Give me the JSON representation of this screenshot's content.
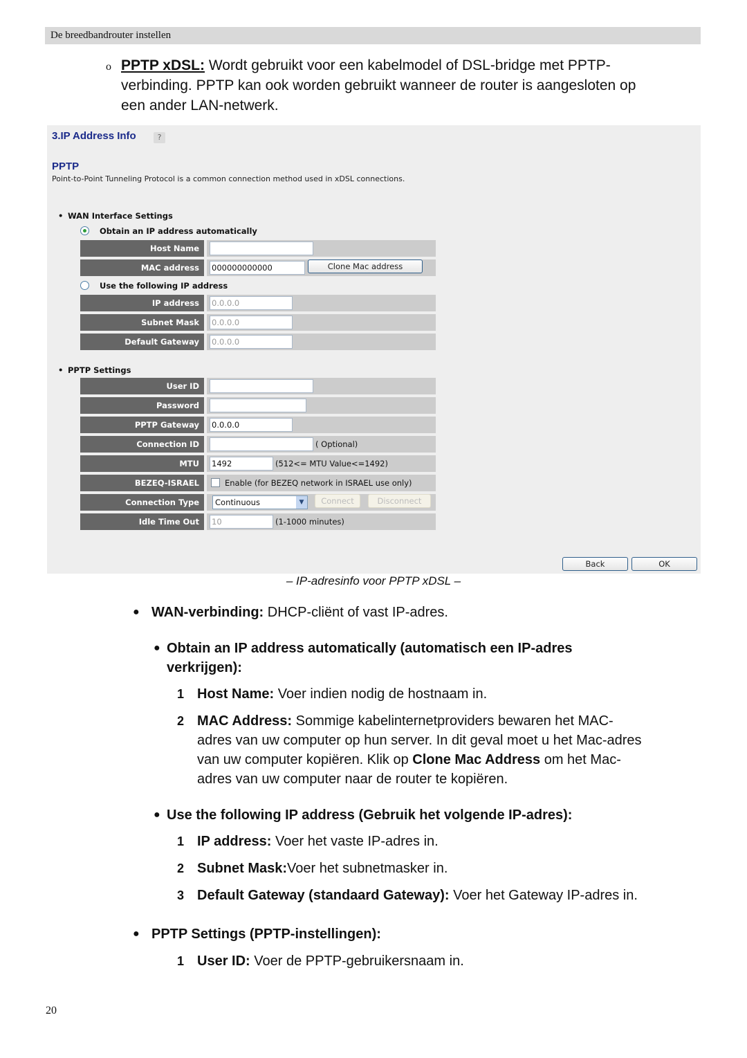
{
  "header": {
    "running_title": "De breedbandrouter instellen"
  },
  "intro": {
    "bullet": "o",
    "term": "PPTP xDSL:",
    "line1": " Wordt gebruikt voor een kabelmodel of DSL-bridge met PPTP-",
    "line2": "verbinding. PPTP kan ook worden gebruikt wanneer de router is aangesloten op",
    "line3": "een ander LAN-netwerk."
  },
  "screenshot": {
    "title": "3.IP Address Info",
    "help_icon": "help-icon",
    "section_title": "PPTP",
    "description": "Point-to-Point Tunneling Protocol is a common connection method used in xDSL connections.",
    "wan_heading": "WAN Interface Settings",
    "radio_auto": {
      "label": "Obtain an IP address automatically",
      "checked": true
    },
    "radio_manual": {
      "label": "Use the following IP address",
      "checked": false
    },
    "host_name": {
      "label": "Host Name",
      "value": ""
    },
    "mac_address": {
      "label": "MAC address",
      "value": "000000000000",
      "button": "Clone Mac address"
    },
    "ip_address": {
      "label": "IP address",
      "value": "0.0.0.0"
    },
    "subnet_mask": {
      "label": "Subnet Mask",
      "value": "0.0.0.0"
    },
    "default_gateway": {
      "label": "Default Gateway",
      "value": "0.0.0.0"
    },
    "pptp_heading": "PPTP Settings",
    "user_id": {
      "label": "User ID",
      "value": ""
    },
    "password": {
      "label": "Password",
      "value": ""
    },
    "pptp_gateway": {
      "label": "PPTP Gateway",
      "value": "0.0.0.0"
    },
    "connection_id": {
      "label": "Connection ID",
      "value": "",
      "note": "( Optional)"
    },
    "mtu": {
      "label": "MTU",
      "value": "1492",
      "note": "(512<= MTU Value<=1492)"
    },
    "bezeq": {
      "label": "BEZEQ-ISRAEL",
      "checked": false,
      "note": "Enable (for BEZEQ network in ISRAEL use only)"
    },
    "connection_type": {
      "label": "Connection Type",
      "selected": "Continuous",
      "connect": "Connect",
      "disconnect": "Disconnect"
    },
    "idle_timeout": {
      "label": "Idle Time Out",
      "value": "10",
      "note": "(1-1000 minutes)"
    },
    "back": "Back",
    "ok": "OK"
  },
  "caption": "– IP-adresinfo voor PPTP xDSL –",
  "items": {
    "wan": {
      "term": "WAN-verbinding:",
      "text": " DHCP-cliënt of vast IP-adres."
    },
    "obtain": {
      "line1": "Obtain an IP address automatically (automatisch een IP-adres",
      "line2": "verkrijgen):"
    },
    "obtain_list": [
      {
        "num": "1",
        "term": "Host Name:",
        "text": " Voer indien nodig de hostnaam in."
      },
      {
        "num": "2",
        "term": "MAC Address:",
        "l1": " Sommige kabelinternetproviders bewaren het MAC-",
        "l2": "adres van uw computer op hun server. In dit geval moet u het Mac-adres",
        "l3a": "van uw computer kopiëren. Klik op ",
        "l3b": "Clone Mac Address",
        "l3c": " om het Mac-",
        "l4": "adres van uw computer naar de router te kopiëren."
      }
    ],
    "use": {
      "text": "Use the following IP address (Gebruik het volgende IP-adres):"
    },
    "use_list": [
      {
        "num": "1",
        "term": "IP address:",
        "text": " Voer het vaste IP-adres in."
      },
      {
        "num": "2",
        "term": "Subnet Mask:",
        "text": "Voer het subnetmasker in."
      },
      {
        "num": "3",
        "term": "Default Gateway (standaard Gateway):",
        "text": " Voer het Gateway IP-adres in."
      }
    ],
    "pptp": {
      "text": "PPTP Settings (PPTP-instellingen):"
    },
    "pptp_list": [
      {
        "num": "1",
        "term": "User ID:",
        "text": " Voer de PPTP-gebruikersnaam in."
      }
    ]
  },
  "page_number": "20"
}
